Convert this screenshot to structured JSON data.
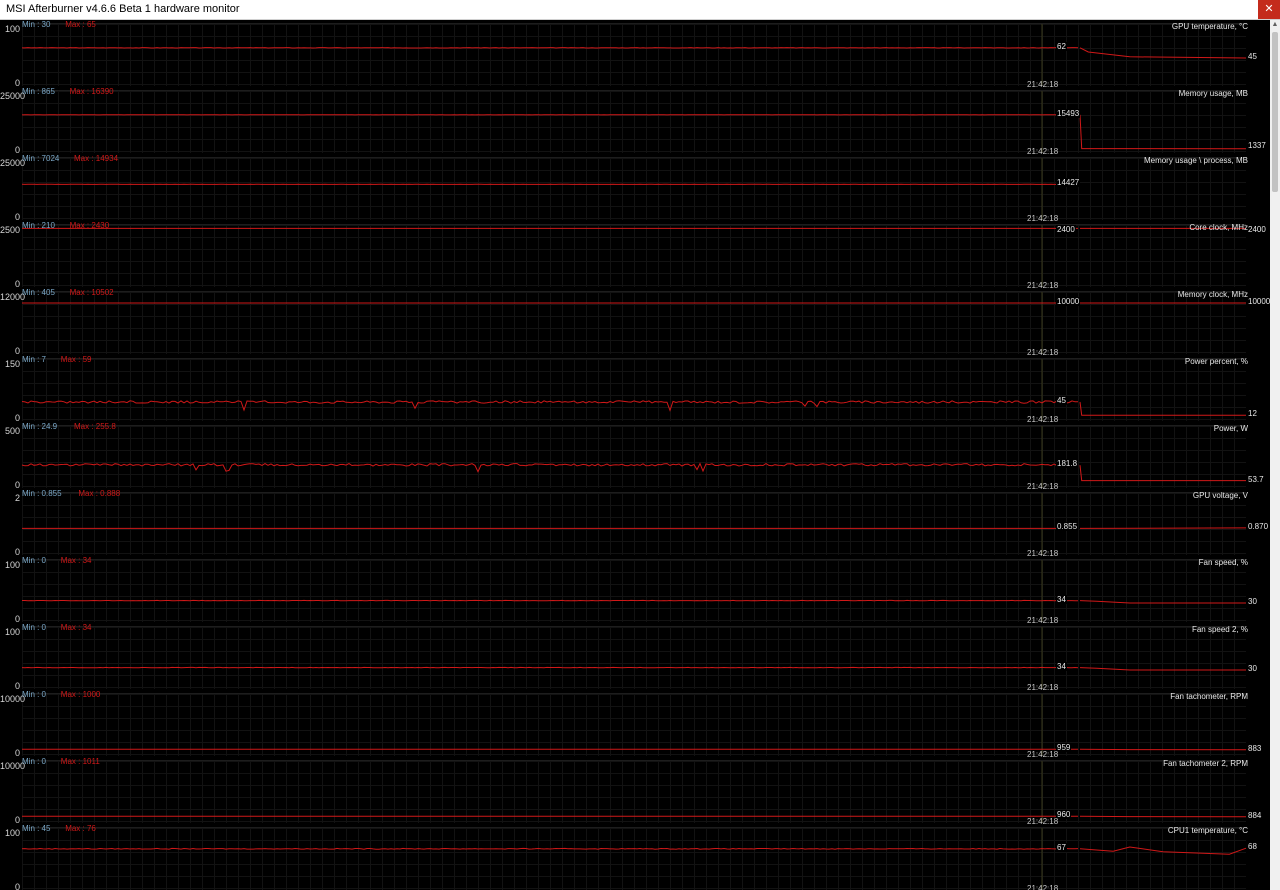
{
  "window": {
    "title": "MSI Afterburner v4.6.6 Beta 1 hardware monitor",
    "close_glyph": "✕"
  },
  "cursor_time": "21:42:18",
  "trace_color": "#d01818",
  "min_color": "#7aa7c7",
  "graphs": [
    {
      "name": "GPU temperature, °C",
      "ymax": "100",
      "ymin": "0",
      "min": "Min : 30",
      "max": "Max : 65",
      "current": "62",
      "last": "45",
      "range": [
        0,
        100
      ],
      "before": {
        "level": 62,
        "noise": 0.4
      },
      "after": [
        [
          0,
          62
        ],
        [
          0.05,
          55
        ],
        [
          0.3,
          47
        ],
        [
          1,
          45
        ]
      ]
    },
    {
      "name": "Memory usage, MB",
      "ymax": "25000",
      "ymin": "0",
      "min": "Min : 865",
      "max": "Max : 16390",
      "current": "15493",
      "last": "1337",
      "range": [
        0,
        25000
      ],
      "before": {
        "level": 15493,
        "noise": 20
      },
      "after": [
        [
          0,
          15493
        ],
        [
          0.01,
          1400
        ],
        [
          1,
          1337
        ]
      ]
    },
    {
      "name": "Memory usage \\ process, MB",
      "ymax": "25000",
      "ymin": "0",
      "min": "Min : 7024",
      "max": "Max : 14934",
      "current": "14427",
      "last": "",
      "range": [
        0,
        25000
      ],
      "before": {
        "level": 14427,
        "noise": 30
      },
      "after": []
    },
    {
      "name": "Core clock, MHz",
      "ymax": "2500",
      "ymin": "0",
      "min": "Min : 210",
      "max": "Max : 2430",
      "current": "2400",
      "last": "2400",
      "range": [
        0,
        2500
      ],
      "before": {
        "level": 2400,
        "noise": 0
      },
      "after": [
        [
          0,
          2400
        ],
        [
          1,
          2400
        ]
      ]
    },
    {
      "name": "Memory clock, MHz",
      "ymax": "12000",
      "ymin": "0",
      "min": "Min : 405",
      "max": "Max : 10502",
      "current": "10000",
      "last": "10000",
      "range": [
        0,
        12000
      ],
      "before": {
        "level": 10000,
        "noise": 0
      },
      "after": [
        [
          0,
          10000
        ],
        [
          1,
          10000
        ]
      ]
    },
    {
      "name": "Power percent, %",
      "ymax": "150",
      "ymin": "0",
      "min": "Min : 7",
      "max": "Max : 59",
      "current": "45",
      "last": "12",
      "range": [
        0,
        150
      ],
      "before": {
        "level": 45,
        "noise": 3,
        "spikes": true
      },
      "after": [
        [
          0,
          45
        ],
        [
          0.01,
          12
        ],
        [
          1,
          12
        ]
      ]
    },
    {
      "name": "Power, W",
      "ymax": "500",
      "ymin": "0",
      "min": "Min : 24.9",
      "max": "Max : 255.8",
      "current": "181.8",
      "last": "53.7",
      "range": [
        0,
        500
      ],
      "before": {
        "level": 185,
        "noise": 10,
        "spikes": true
      },
      "after": [
        [
          0,
          181.8
        ],
        [
          0.01,
          53.7
        ],
        [
          1,
          53.7
        ]
      ]
    },
    {
      "name": "GPU voltage, V",
      "ymax": "2",
      "ymin": "0",
      "min": "Min : 0.855",
      "max": "Max : 0.888",
      "current": "0.855",
      "last": "0.870",
      "range": [
        0,
        2
      ],
      "before": {
        "level": 0.855,
        "noise": 0
      },
      "after": [
        [
          0,
          0.855
        ],
        [
          1,
          0.87
        ]
      ]
    },
    {
      "name": "Fan speed, %",
      "ymax": "100",
      "ymin": "0",
      "min": "Min : 0",
      "max": "Max : 34",
      "current": "34",
      "last": "30",
      "range": [
        0,
        100
      ],
      "before": {
        "level": 34,
        "noise": 0.3
      },
      "after": [
        [
          0,
          34
        ],
        [
          0.1,
          33
        ],
        [
          0.3,
          30
        ],
        [
          1,
          30
        ]
      ]
    },
    {
      "name": "Fan speed 2, %",
      "ymax": "100",
      "ymin": "0",
      "min": "Min : 0",
      "max": "Max : 34",
      "current": "34",
      "last": "30",
      "range": [
        0,
        100
      ],
      "before": {
        "level": 34,
        "noise": 0.3
      },
      "after": [
        [
          0,
          34
        ],
        [
          0.1,
          33
        ],
        [
          0.3,
          30
        ],
        [
          1,
          30
        ]
      ]
    },
    {
      "name": "Fan tachometer, RPM",
      "ymax": "10000",
      "ymin": "0",
      "min": "Min : 0",
      "max": "Max : 1000",
      "current": "959",
      "last": "883",
      "range": [
        0,
        10000
      ],
      "before": {
        "level": 959,
        "noise": 5
      },
      "after": [
        [
          0,
          959
        ],
        [
          0.3,
          900
        ],
        [
          1,
          883
        ]
      ]
    },
    {
      "name": "Fan tachometer 2, RPM",
      "ymax": "10000",
      "ymin": "0",
      "min": "Min : 0",
      "max": "Max : 1011",
      "current": "960",
      "last": "884",
      "range": [
        0,
        10000
      ],
      "before": {
        "level": 960,
        "noise": 5
      },
      "after": [
        [
          0,
          960
        ],
        [
          0.3,
          900
        ],
        [
          1,
          884
        ]
      ]
    },
    {
      "name": "CPU1 temperature, °C",
      "ymax": "100",
      "ymin": "0",
      "min": "Min : 45",
      "max": "Max : 76",
      "current": "67",
      "last": "68",
      "range": [
        0,
        100
      ],
      "before": {
        "level": 67,
        "noise": 0.6
      },
      "after": [
        [
          0,
          67
        ],
        [
          0.2,
          63
        ],
        [
          0.3,
          70
        ],
        [
          0.5,
          62
        ],
        [
          0.9,
          58
        ],
        [
          1,
          68
        ]
      ]
    }
  ]
}
